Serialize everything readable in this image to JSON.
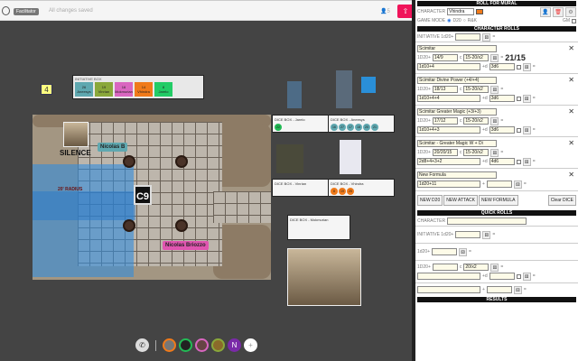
{
  "topbar": {
    "facilitator_label": "Facilitator",
    "status": "All changes saved",
    "user_count": "5"
  },
  "canvas": {
    "sticky_note": "4",
    "initiative_box": {
      "title": "INITIATIVE BOX",
      "entries": [
        {
          "value": "26",
          "name": "Aneesys",
          "color": "#5fa8b0"
        },
        {
          "value": "19",
          "name": "Vinrian",
          "color": "#8aa83a"
        },
        {
          "value": "16",
          "name": "Mokmurian",
          "color": "#d966c0"
        },
        {
          "value": "14",
          "name": "Vhindra",
          "color": "#f07a1a"
        },
        {
          "value": "8",
          "name": "Jarelo",
          "color": "#22cc66"
        }
      ]
    },
    "map": {
      "silence": "SILENCE",
      "radius": "20' RADIUS",
      "room_code": "C9",
      "label_nicolas_b": "Nicolas B",
      "label_nicolas_briozzo": "Nicolas Briozzo"
    },
    "dice_boxes": [
      {
        "title": "DICE BOX - Jarelo",
        "color": "#22bb55",
        "values": [
          "22"
        ]
      },
      {
        "title": "DICE BOX - Aneesys",
        "color": "#5fa8b0",
        "values": [
          "16",
          "27",
          "17",
          "18",
          "20",
          "21"
        ]
      },
      {
        "title": "DICE BOX - Vinrian",
        "color": "#8aa83a",
        "values": []
      },
      {
        "title": "DICE BOX - Vhindra",
        "color": "#f07a1a",
        "values": [
          "8",
          "19",
          "25"
        ]
      },
      {
        "title": "DICE BOX - Mokmurian",
        "color": "#d966c0",
        "values": []
      }
    ]
  },
  "bottom_bar": {
    "participant_initial": "N"
  },
  "panel": {
    "title": "ROLL FOR MURAL",
    "character_label": "CHARACTER",
    "character_value": "Vhindra",
    "game_mode_label": "GAME MODE",
    "mode_d20": "D20",
    "mode_rk": "R&K",
    "gm_label": "GM",
    "character_rolls_title": "CHARACTER ROLLS",
    "initiative_label": "INITIATIVE 1d20+",
    "rolls": [
      {
        "name": "Scimitar",
        "d20_label": "1D20+",
        "attack": "14/9",
        "crit": "15-20/x2",
        "result": "21/15",
        "damage": "1d10+4",
        "extra": "3d6"
      },
      {
        "name": "Scimitar Divine Power (+4/+4)",
        "d20_label": "1D20+",
        "attack": "18/13",
        "crit": "15-20/x2",
        "result": "",
        "damage": "1d10+4+4",
        "extra": "3d6"
      },
      {
        "name": "Scimitar Greater Magic (+3/+3)",
        "d20_label": "1D20+",
        "attack": "17/12",
        "crit": "15-20/x2",
        "result": "",
        "damage": "1d10+4+3",
        "extra": "3d6"
      },
      {
        "name": "Scimitar - Greater Magic W + Di",
        "d20_label": "1D20+",
        "attack": "20/20/15",
        "crit": "15-20/x2",
        "result": "",
        "damage": "2d8+4+3+2",
        "extra": "4d6"
      }
    ],
    "formula": {
      "name": "New Formula",
      "value": "1d20+11"
    },
    "buttons": {
      "new_d20": "NEW D20",
      "new_attack": "NEW ATTACK",
      "new_formula": "NEW FORMULA",
      "clear_dice": "Clear DICE"
    },
    "quick_rolls_title": "QUICK ROLLS",
    "quick": {
      "character_label": "CHARACTER",
      "initiative_label": "INITIATIVE 1d20+",
      "d20_label": "1d20+",
      "attack_label": "1D20+",
      "crit": "20/x2"
    },
    "results_title": "RESULTS"
  }
}
